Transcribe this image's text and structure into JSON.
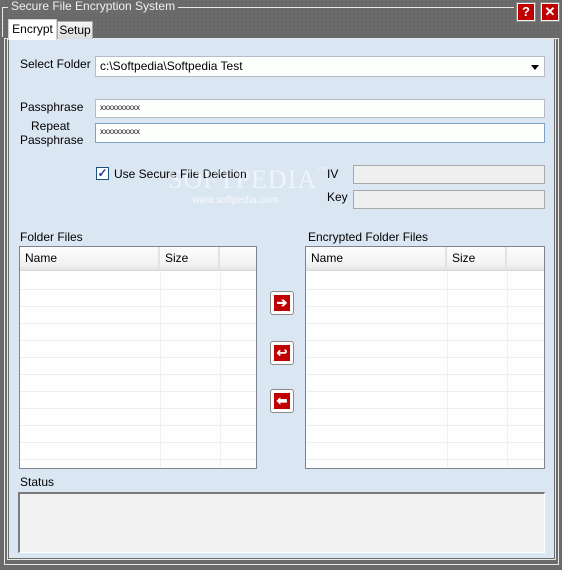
{
  "window": {
    "title": "Secure File Encryption System",
    "help_icon": "?",
    "close_icon": "✕"
  },
  "tabs": [
    {
      "label": "Encrypt",
      "active": true
    },
    {
      "label": "Setup",
      "active": false
    }
  ],
  "form": {
    "select_folder_label": "Select Folder",
    "select_folder_value": "c:\\Softpedia\\Softpedia Test",
    "passphrase_label": "Passphrase",
    "passphrase_value": "xxxxxxxxxx",
    "repeat_label_line1": "Repeat",
    "repeat_label_line2": "Passphrase",
    "repeat_value": "xxxxxxxxxx",
    "secure_delete_label": "Use Secure File Deletion",
    "secure_delete_checked": true,
    "checkmark": "✓",
    "iv_label": "IV",
    "iv_value": "",
    "key_label": "Key",
    "key_value": ""
  },
  "watermark": {
    "brand": "SOFTPEDIA",
    "tm": "™",
    "url": "www.softpedia.com"
  },
  "folder_files": {
    "label": "Folder Files",
    "columns": [
      "Name",
      "Size"
    ],
    "rows": []
  },
  "encrypted_files": {
    "label": "Encrypted Folder Files",
    "columns": [
      "Name",
      "Size"
    ],
    "rows": []
  },
  "actions": {
    "encrypt_icon": "➔",
    "refresh_icon": "↩",
    "decrypt_icon": "⬅"
  },
  "status": {
    "label": "Status",
    "text": ""
  }
}
